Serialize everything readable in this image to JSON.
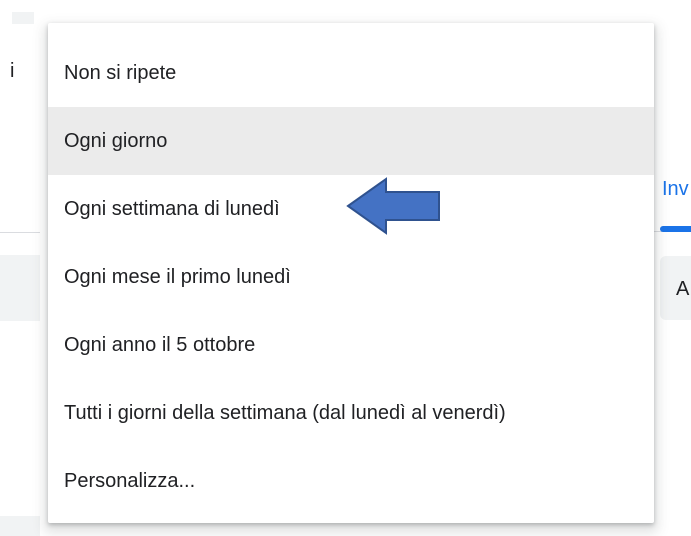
{
  "background": {
    "left_text": "i",
    "tab_label": "Inv",
    "field_label": "A"
  },
  "menu": {
    "items": [
      {
        "label": "Non si ripete"
      },
      {
        "label": "Ogni giorno",
        "hovered": true
      },
      {
        "label": "Ogni settimana di lunedì"
      },
      {
        "label": "Ogni mese il primo lunedì"
      },
      {
        "label": "Ogni anno il 5 ottobre"
      },
      {
        "label": "Tutti i giorni della settimana (dal lunedì al venerdì)"
      },
      {
        "label": "Personalizza..."
      }
    ]
  },
  "annotation": {
    "icon": "left-arrow-icon",
    "color": "#4472c4",
    "outline": "#2f528f"
  },
  "colors": {
    "accent": "#1a73e8",
    "hover": "#ebebeb",
    "text": "#202124"
  }
}
